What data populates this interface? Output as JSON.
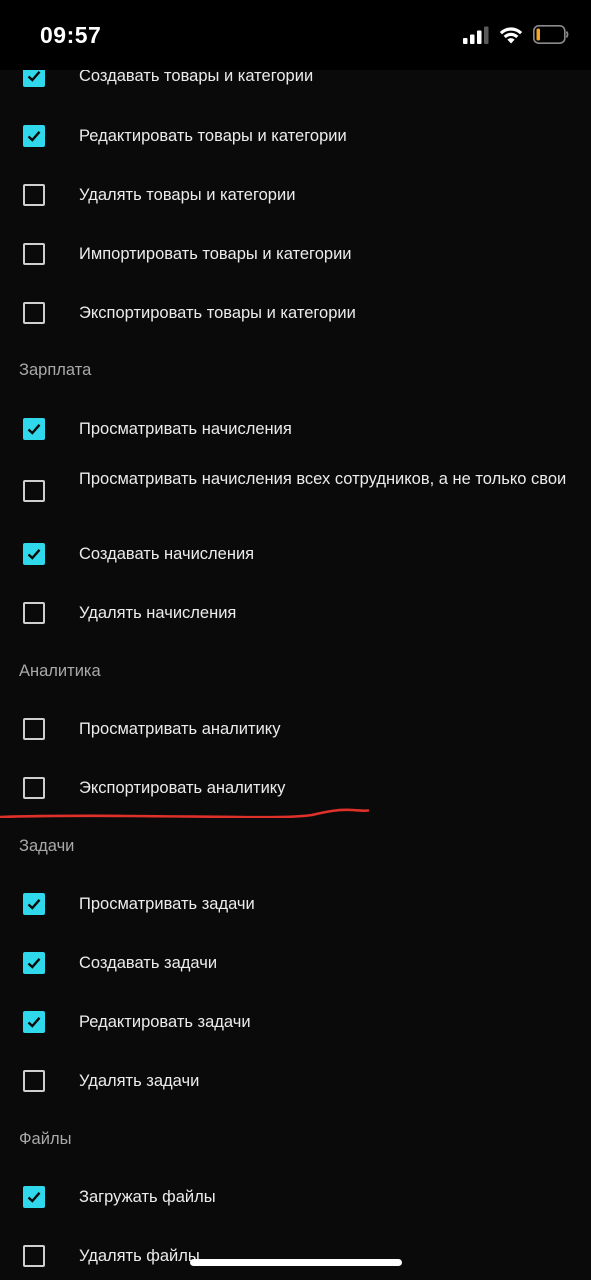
{
  "status_bar": {
    "time": "09:57",
    "signal_icon": "cellular-signal-icon",
    "wifi_icon": "wifi-icon",
    "battery_icon": "battery-low-icon"
  },
  "colors": {
    "background": "#0a0a0a",
    "accent": "#2fd8ea",
    "checkbox_border": "#cfcfcf",
    "section_header": "#a9a9a9",
    "annotation_line": "#e0302a"
  },
  "permissions": {
    "products": {
      "items": [
        {
          "label": "Создавать товары и категории",
          "checked": true
        },
        {
          "label": "Редактировать товары и категории",
          "checked": true
        },
        {
          "label": "Удалять товары и категории",
          "checked": false
        },
        {
          "label": "Импортировать товары и категории",
          "checked": false
        },
        {
          "label": "Экспортировать товары и категории",
          "checked": false
        }
      ]
    },
    "salary": {
      "title": "Зарплата",
      "items": [
        {
          "label": "Просматривать начисления",
          "checked": true
        },
        {
          "label": "Просматривать начисления всех сотрудников, а не только свои",
          "checked": false
        },
        {
          "label": "Создавать начисления",
          "checked": true
        },
        {
          "label": "Удалять начисления",
          "checked": false
        }
      ]
    },
    "analytics": {
      "title": "Аналитика",
      "items": [
        {
          "label": "Просматривать аналитику",
          "checked": false
        },
        {
          "label": "Экспортировать аналитику",
          "checked": false
        }
      ]
    },
    "tasks": {
      "title": "Задачи",
      "items": [
        {
          "label": "Просматривать задачи",
          "checked": true
        },
        {
          "label": "Создавать задачи",
          "checked": true
        },
        {
          "label": "Редактировать задачи",
          "checked": true
        },
        {
          "label": "Удалять задачи",
          "checked": false
        }
      ]
    },
    "files": {
      "title": "Файлы",
      "items": [
        {
          "label": "Загружать файлы",
          "checked": true
        },
        {
          "label": "Удалять файлы",
          "checked": false
        }
      ]
    }
  }
}
